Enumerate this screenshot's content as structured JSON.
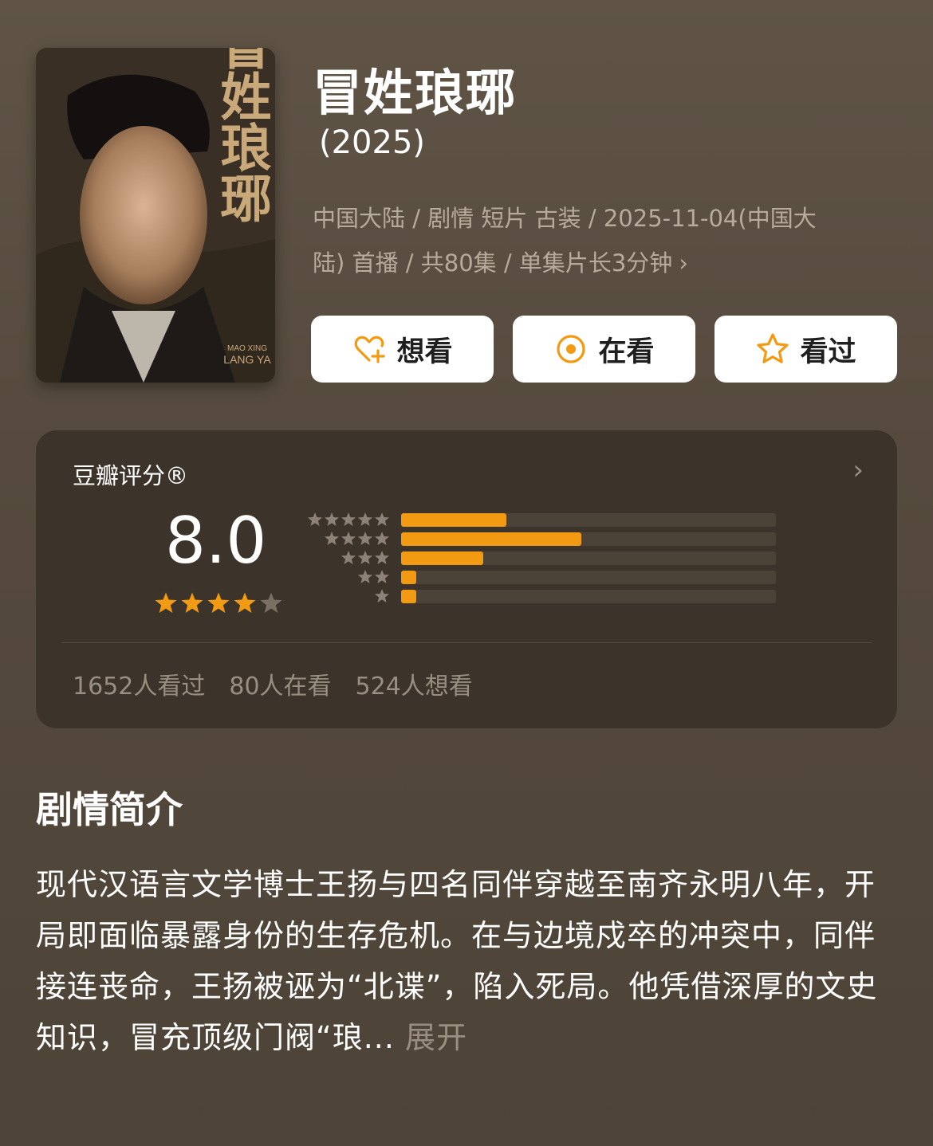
{
  "poster": {
    "calligraphy": "冒姓琅琊",
    "roman_line1": "MAO XING",
    "roman_line2": "LANG YA"
  },
  "header": {
    "title": "冒姓琅琊",
    "year": "(2025)",
    "meta_line1": "中国大陆 / 剧情 短片 古装 / 2025-11-04(中国大",
    "meta_line2": "陆) 首播 / 共80集 / 单集片长3分钟"
  },
  "actions": [
    {
      "label": "想看",
      "icon": "heart-plus-icon"
    },
    {
      "label": "在看",
      "icon": "target-icon"
    },
    {
      "label": "看过",
      "icon": "star-outline-icon"
    }
  ],
  "rating": {
    "label": "豆瓣评分®",
    "score": "8.0",
    "stars_value": 4,
    "stars_max": 5,
    "distribution": [
      {
        "stars": 5,
        "fraction": 0.28
      },
      {
        "stars": 4,
        "fraction": 0.48
      },
      {
        "stars": 3,
        "fraction": 0.22
      },
      {
        "stars": 2,
        "fraction": 0.04
      },
      {
        "stars": 1,
        "fraction": 0.04
      }
    ],
    "counts": {
      "watched": "1652人看过",
      "watching": "80人在看",
      "want": "524人想看"
    }
  },
  "synopsis": {
    "title": "剧情简介",
    "text": "现代汉语言文学博士王扬与四名同伴穿越至南齐永明八年，开局即面临暴露身份的生存危机。在与边境戍卒的冲突中，同伴接连丧命，王扬被诬为“北谍”，陷入死局。他凭借深厚的文史知识，冒充顶级门阀“琅...",
    "expand": "展开"
  },
  "colors": {
    "accent": "#f29b12",
    "background": "#574c3f",
    "card": "#3c342b",
    "muted_text": "#9a8e80"
  }
}
